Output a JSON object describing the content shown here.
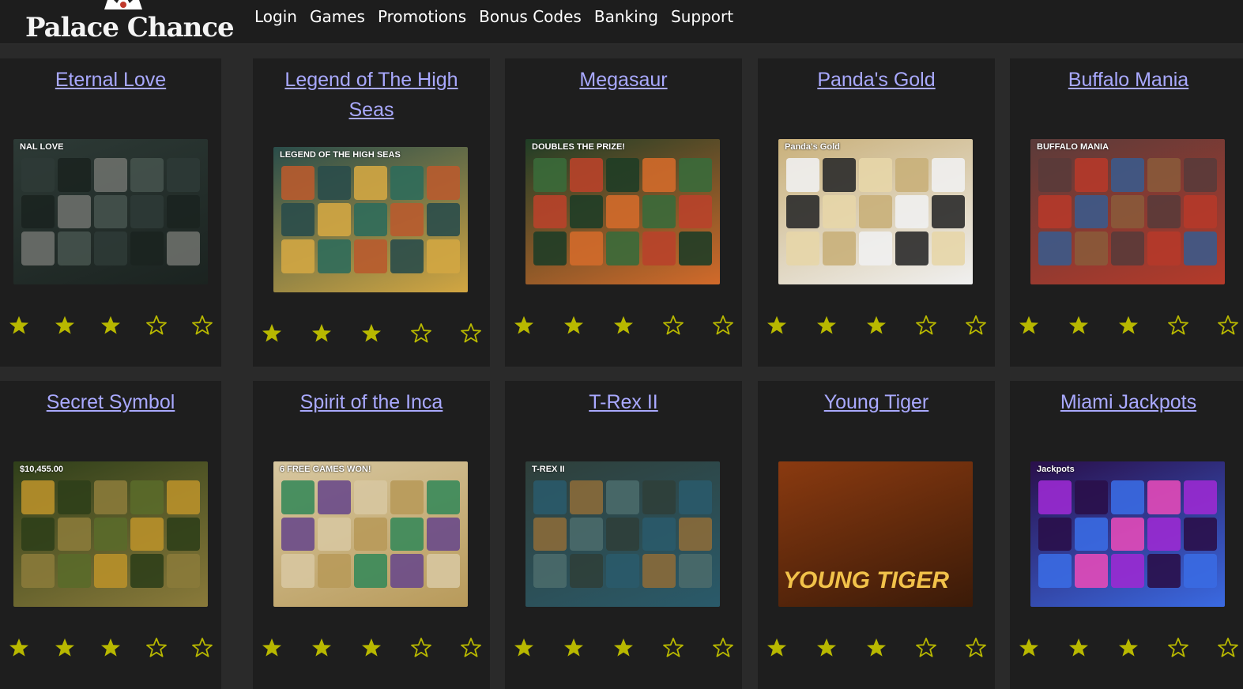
{
  "header": {
    "logo_text": "Palace Chance",
    "nav": [
      "Login",
      "Games",
      "Promotions",
      "Bonus Codes",
      "Banking",
      "Support"
    ]
  },
  "colors": {
    "background": "#2a2a2a",
    "card": "#1e1e1e",
    "link": "#a9a9ff",
    "star": "#b8b800"
  },
  "games": [
    {
      "title": "Eternal Love",
      "rating": 3,
      "max": 5,
      "thumb_overlay": "NAL LOVE"
    },
    {
      "title": "Legend of The High Seas",
      "rating": 3,
      "max": 5,
      "thumb_overlay": "LEGEND OF THE HIGH SEAS"
    },
    {
      "title": "Megasaur",
      "rating": 3,
      "max": 5,
      "thumb_overlay": "DOUBLES THE PRIZE!"
    },
    {
      "title": "Panda's Gold",
      "rating": 3,
      "max": 5,
      "thumb_overlay": "Panda's Gold"
    },
    {
      "title": "Buffalo Mania",
      "rating": 3,
      "max": 5,
      "thumb_overlay": "BUFFALO MANIA"
    },
    {
      "title": "Secret Symbol",
      "rating": 3,
      "max": 5,
      "thumb_overlay": "$10,455.00"
    },
    {
      "title": "Spirit of the Inca",
      "rating": 3,
      "max": 5,
      "thumb_overlay": "6 FREE GAMES WON!"
    },
    {
      "title": "T-Rex II",
      "rating": 3,
      "max": 5,
      "thumb_overlay": "T-REX II"
    },
    {
      "title": "Young Tiger",
      "rating": 3,
      "max": 5,
      "thumb_overlay": "YOUNG TIGER"
    },
    {
      "title": "Miami Jackpots",
      "rating": 3,
      "max": 5,
      "thumb_overlay": "Jackpots"
    }
  ]
}
